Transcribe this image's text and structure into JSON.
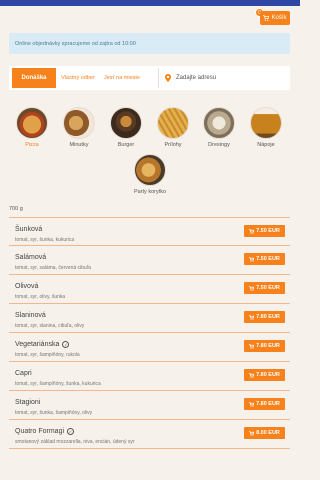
{
  "header": {
    "cart_label": "Košík",
    "cart_count": "0"
  },
  "notice": "Online objednávky spracujeme od zajtra od 10:00",
  "order": {
    "delivery": "Donáška",
    "pickup": "Vlastný odber",
    "dine_in": "Jesť na mieste",
    "address_placeholder": "Zadajte adresu"
  },
  "categories": [
    {
      "label": "Pizza"
    },
    {
      "label": "Minutky"
    },
    {
      "label": "Burger"
    },
    {
      "label": "Prílohy"
    },
    {
      "label": "Dresingy"
    },
    {
      "label": "Nápoje"
    },
    {
      "label": "Party korytko"
    }
  ],
  "weight": "700 g",
  "items": [
    {
      "name": "Šunková",
      "desc": "tomat, syr, šunka, kukurica",
      "price": "7.50 EUR"
    },
    {
      "name": "Salámová",
      "desc": "tomat, syr, saláma, červená cibuľa",
      "price": "7.50 EUR"
    },
    {
      "name": "Olivová",
      "desc": "tomat, syr, olivy, šunka",
      "price": "7.50 EUR"
    },
    {
      "name": "Slaninová",
      "desc": "tomat, syr, slanina, cibuľa, olivy",
      "price": "7.80 EUR"
    },
    {
      "name": "Vegetariánska",
      "desc": "tomat, syr, šampiňóny, rukola",
      "price": "7.80 EUR"
    },
    {
      "name": "Capri",
      "desc": "tomat, syr, šampiňóny, šunka, kukurica",
      "price": "7.80 EUR"
    },
    {
      "name": "Stagioni",
      "desc": "tomat, syr, šunka, šampiňóny, olivy",
      "price": "7.80 EUR"
    },
    {
      "name": "Quatro Formagi",
      "desc": "smotanový základ mozzarella, niva, encián, údený syr",
      "price": "8.00 EUR"
    }
  ]
}
